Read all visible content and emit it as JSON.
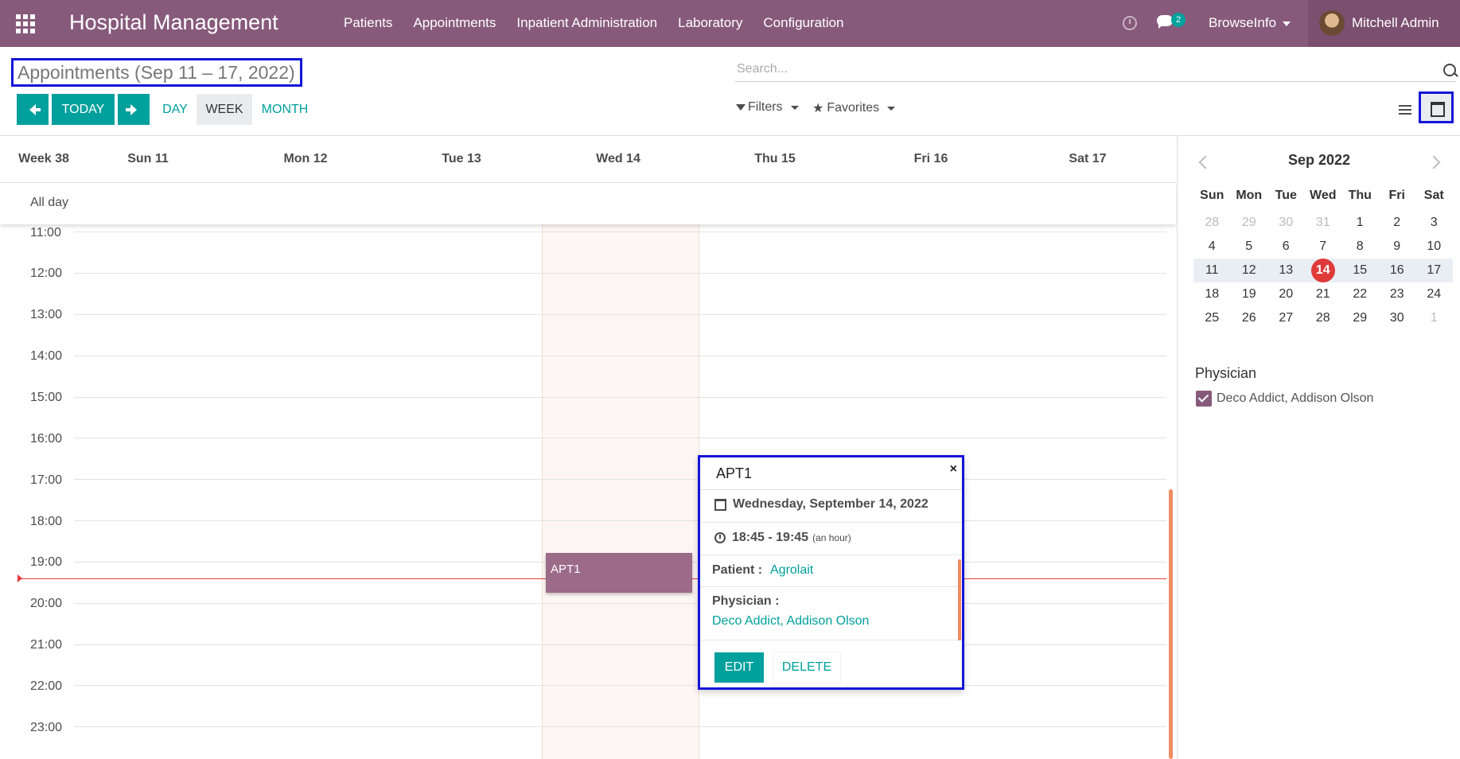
{
  "navbar": {
    "brand": "Hospital Management",
    "menu": [
      "Patients",
      "Appointments",
      "Inpatient Administration",
      "Laboratory",
      "Configuration"
    ],
    "chat_count": "2",
    "company": "BrowseInfo",
    "user": "Mitchell Admin",
    "color": "#875a7b"
  },
  "control": {
    "title": "Appointments (Sep 11 – 17, 2022)",
    "today_label": "TODAY",
    "scales": [
      "DAY",
      "WEEK",
      "MONTH"
    ],
    "active_scale": "WEEK",
    "search_placeholder": "Search...",
    "filters_label": "Filters",
    "favorites_label": "Favorites"
  },
  "calendar": {
    "week_label": "Week 38",
    "days": [
      "Sun 11",
      "Mon 12",
      "Tue 13",
      "Wed 14",
      "Thu 15",
      "Fri 16",
      "Sat 17"
    ],
    "all_day_label": "All day",
    "hours": [
      "11:00",
      "12:00",
      "13:00",
      "14:00",
      "15:00",
      "16:00",
      "17:00",
      "18:00",
      "19:00",
      "20:00",
      "21:00",
      "22:00",
      "23:00"
    ],
    "event": {
      "title": "APT1"
    }
  },
  "popover": {
    "title": "APT1",
    "close": "×",
    "date": "Wednesday, September 14, 2022",
    "time": "18:45 - 19:45",
    "duration": "(an hour)",
    "patient_label": "Patient :",
    "patient": "Agrolait",
    "physician_label": "Physician :",
    "physician": "Deco Addict, Addison Olson",
    "edit": "EDIT",
    "delete": "DELETE"
  },
  "sidebar": {
    "month_title": "Sep 2022",
    "weekdays": [
      "Sun",
      "Mon",
      "Tue",
      "Wed",
      "Thu",
      "Fri",
      "Sat"
    ],
    "weeks": [
      [
        "28",
        "29",
        "30",
        "31",
        "1",
        "2",
        "3"
      ],
      [
        "4",
        "5",
        "6",
        "7",
        "8",
        "9",
        "10"
      ],
      [
        "11",
        "12",
        "13",
        "14",
        "15",
        "16",
        "17"
      ],
      [
        "18",
        "19",
        "20",
        "21",
        "22",
        "23",
        "24"
      ],
      [
        "25",
        "26",
        "27",
        "28",
        "29",
        "30",
        "1"
      ]
    ],
    "today": "14",
    "filter_title": "Physician",
    "filter_item": "Deco Addict, Addison Olson"
  }
}
